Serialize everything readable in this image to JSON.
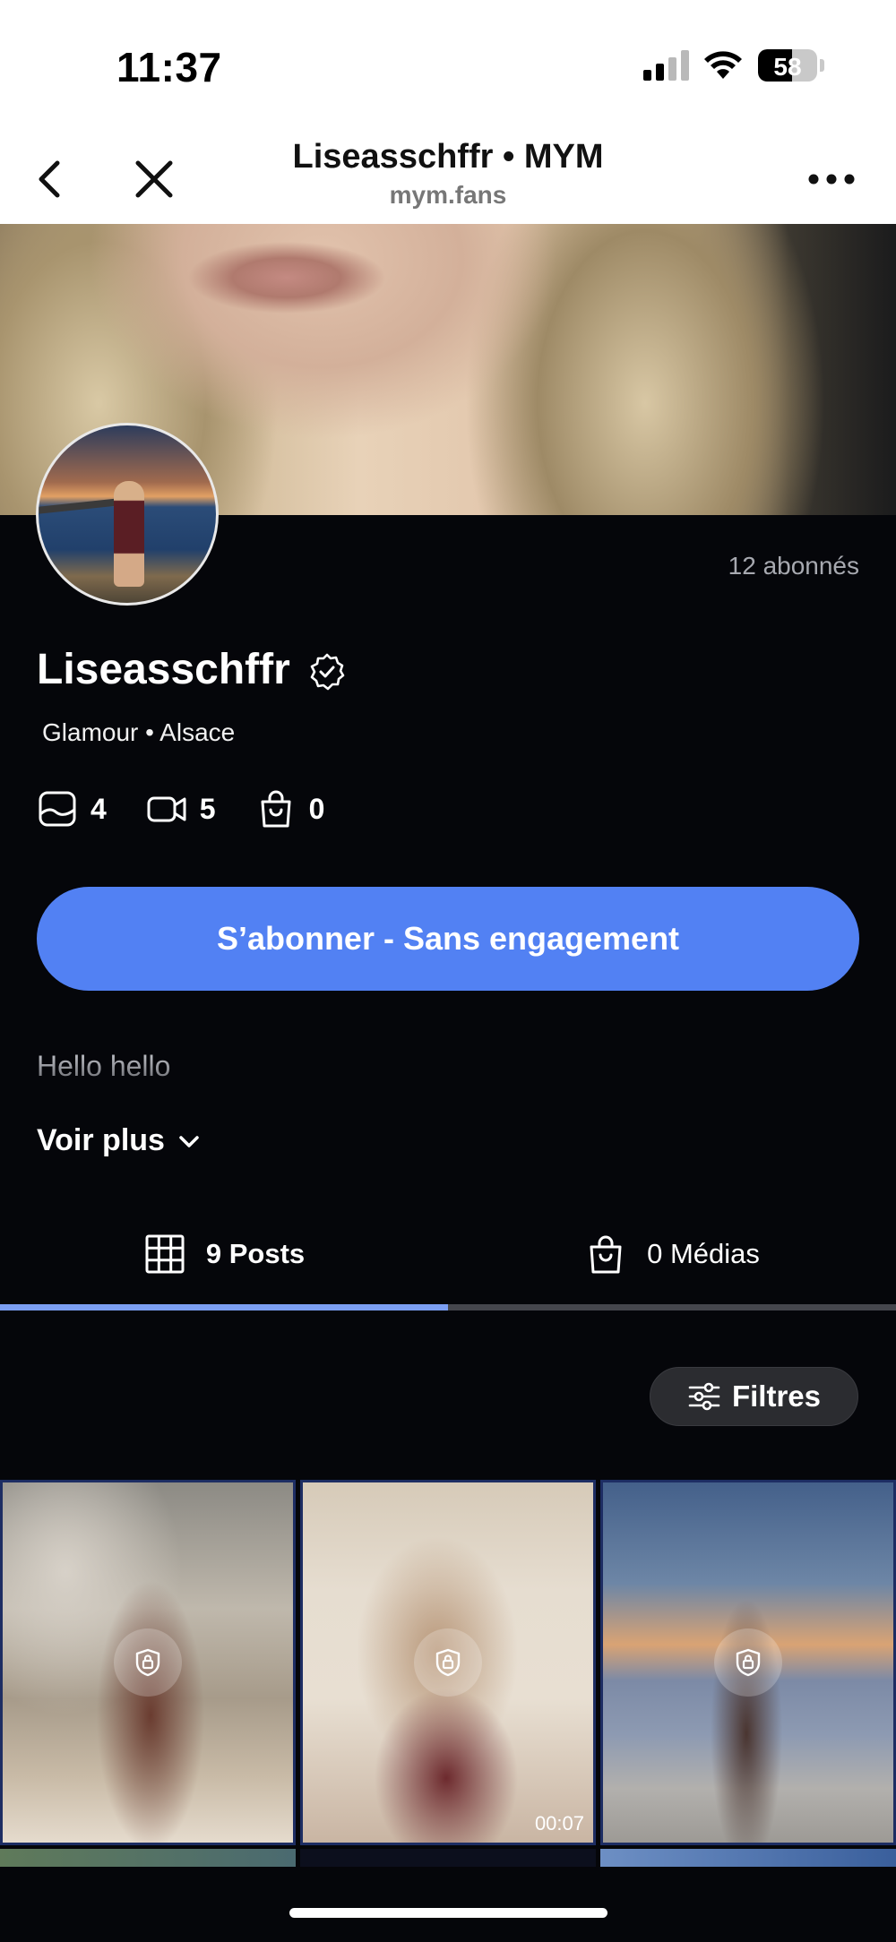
{
  "status_bar": {
    "time": "11:37",
    "battery_level": "58",
    "battery_fraction": 0.58,
    "signal_bars_active": 2,
    "signal_bars_total": 4
  },
  "browser": {
    "title": "Liseasschffr • MYM",
    "domain": "mym.fans",
    "icons": {
      "back": "chevron-left-icon",
      "close": "close-icon",
      "more": "more-horizontal-icon"
    }
  },
  "profile": {
    "subscribers": "12 abonnés",
    "name": "Liseasschffr",
    "categories": "Glamour • Alsace",
    "stats": [
      {
        "icon": "photo-icon",
        "value": "4"
      },
      {
        "icon": "video-icon",
        "value": "5"
      },
      {
        "icon": "shopping-bag-icon",
        "value": "0"
      }
    ],
    "subscribe_label": "S’abonner - Sans engagement",
    "bio": "Hello hello",
    "see_more_label": "Voir plus"
  },
  "tabs": [
    {
      "label": "9 Posts",
      "icon": "grid-icon",
      "active": true
    },
    {
      "label": "0 Médias",
      "icon": "shopping-bag-icon",
      "active": false
    }
  ],
  "filters_label": "Filtres",
  "posts": [
    {
      "locked": true,
      "duration": ""
    },
    {
      "locked": true,
      "duration": "00:07"
    },
    {
      "locked": true,
      "duration": ""
    }
  ],
  "colors": {
    "accent": "#5281f3",
    "background": "#05060a",
    "tab_indicator": "#7b9ef2",
    "muted_text": "#a7a9b0"
  }
}
